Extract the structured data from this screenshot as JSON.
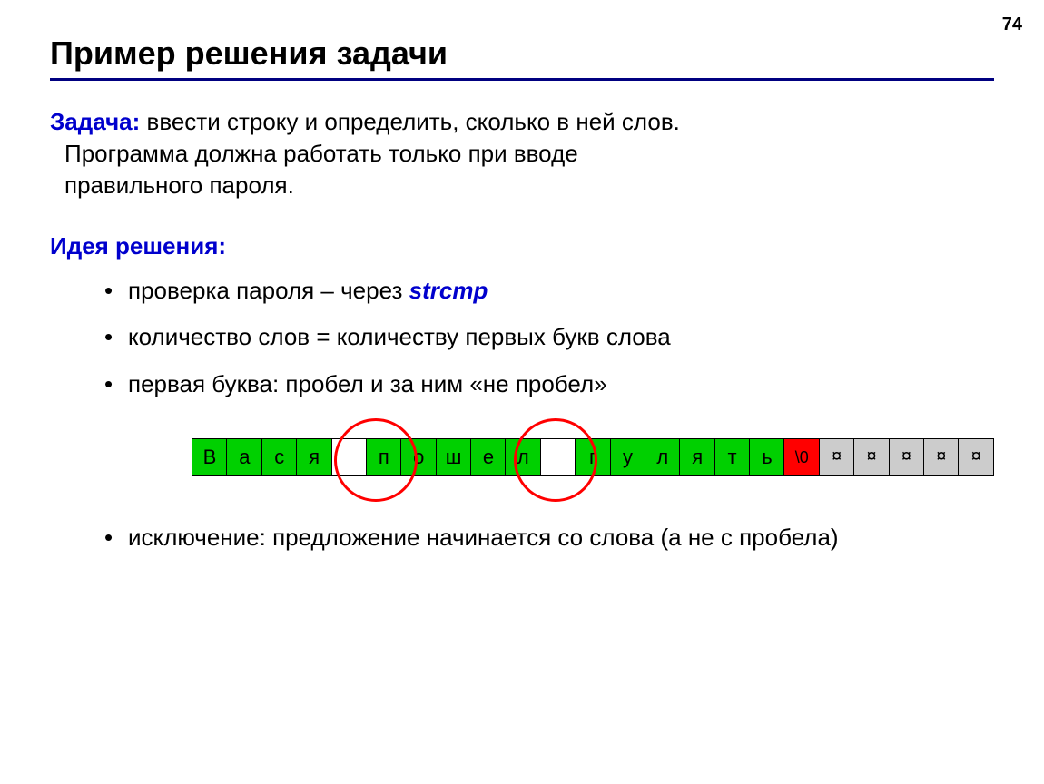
{
  "page_number": "74",
  "title": "Пример решения задачи",
  "task": {
    "label": "Задача:",
    "text_line1_rest": " ввести строку и определить, сколько в ней слов.",
    "text_line2": "Программа должна работать только при вводе",
    "text_line3": "правильного пароля."
  },
  "idea": {
    "label": "Идея решения:",
    "items": [
      {
        "prefix": "проверка пароля – через ",
        "keyword": "strcmp",
        "suffix": ""
      },
      {
        "prefix": "количество слов = количеству первых букв слова",
        "keyword": "",
        "suffix": ""
      },
      {
        "prefix": "первая буква: пробел и за ним «не пробел»",
        "keyword": "",
        "suffix": ""
      },
      {
        "prefix": "исключение: предложение начинается со слова (а не с пробела)",
        "keyword": "",
        "suffix": ""
      }
    ]
  },
  "cells": [
    {
      "ch": "В",
      "cls": "green"
    },
    {
      "ch": "а",
      "cls": "green"
    },
    {
      "ch": "с",
      "cls": "green"
    },
    {
      "ch": "я",
      "cls": "green"
    },
    {
      "ch": "",
      "cls": "white"
    },
    {
      "ch": "п",
      "cls": "green"
    },
    {
      "ch": "о",
      "cls": "green"
    },
    {
      "ch": "ш",
      "cls": "green"
    },
    {
      "ch": "е",
      "cls": "green"
    },
    {
      "ch": "л",
      "cls": "green"
    },
    {
      "ch": "",
      "cls": "white"
    },
    {
      "ch": "г",
      "cls": "green"
    },
    {
      "ch": "у",
      "cls": "green"
    },
    {
      "ch": "л",
      "cls": "green"
    },
    {
      "ch": "я",
      "cls": "green"
    },
    {
      "ch": "т",
      "cls": "green"
    },
    {
      "ch": "ь",
      "cls": "green"
    },
    {
      "ch": "\\0",
      "cls": "red"
    },
    {
      "ch": "¤",
      "cls": "gray"
    },
    {
      "ch": "¤",
      "cls": "gray"
    },
    {
      "ch": "¤",
      "cls": "gray"
    },
    {
      "ch": "¤",
      "cls": "gray"
    },
    {
      "ch": "¤",
      "cls": "gray"
    }
  ]
}
